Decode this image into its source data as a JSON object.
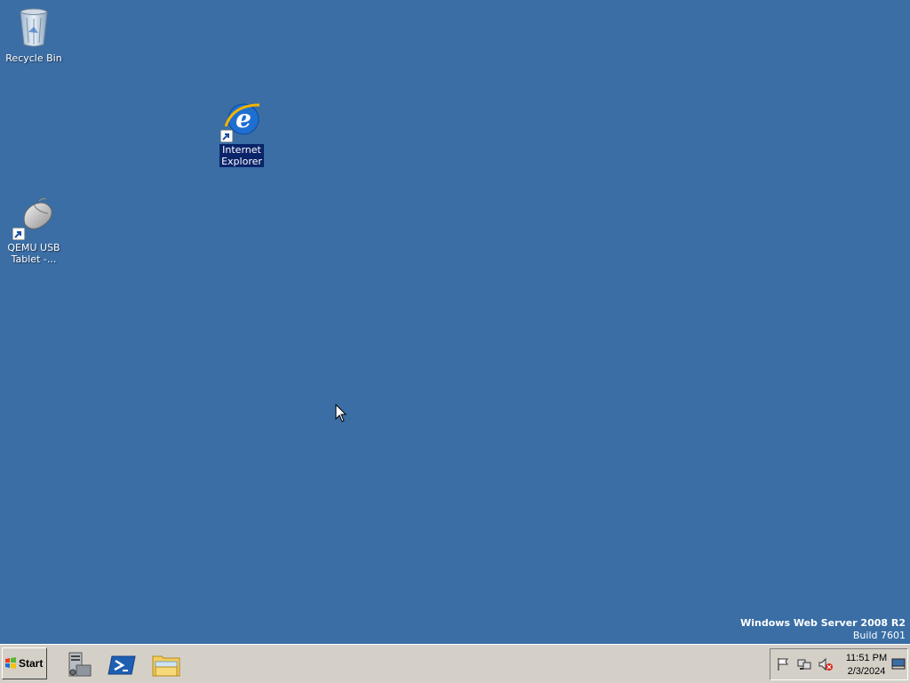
{
  "desktop": {
    "background_color": "#3a6ea5",
    "icons": [
      {
        "label": "Recycle Bin",
        "icon": "recycle-bin-icon",
        "shortcut": false,
        "selected": false
      },
      {
        "label": "Internet\nExplorer",
        "icon": "internet-explorer-icon",
        "shortcut": true,
        "selected": true
      },
      {
        "label": "QEMU USB\nTablet -...",
        "icon": "mouse-device-icon",
        "shortcut": true,
        "selected": false
      }
    ]
  },
  "watermark": {
    "title": "Windows Web Server 2008 R2",
    "build": "Build 7601"
  },
  "taskbar": {
    "start_label": "Start",
    "quick_launch": [
      {
        "icon": "server-manager-icon"
      },
      {
        "icon": "powershell-icon"
      },
      {
        "icon": "windows-explorer-icon"
      }
    ],
    "tray": {
      "icons": [
        "action-center-flag-icon",
        "network-icon",
        "volume-muted-icon"
      ],
      "time": "11:51 PM",
      "date": "2/3/2024",
      "show_desktop_icon": "show-desktop-icon"
    }
  }
}
